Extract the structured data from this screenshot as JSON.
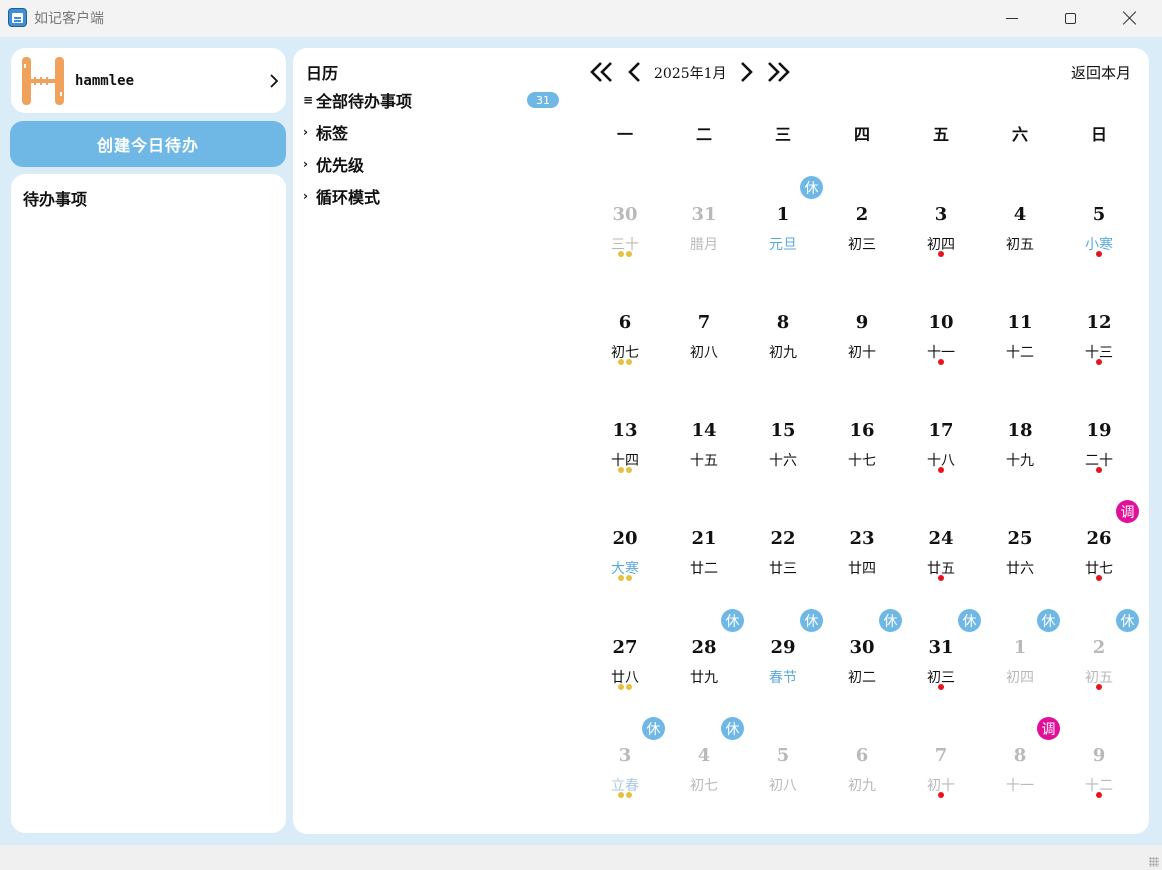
{
  "window": {
    "title": "如记客户端",
    "icon": "calendar-app-icon"
  },
  "user": {
    "name": "hammlee",
    "logo": "H-logo-icon"
  },
  "create_button": {
    "label": "创建今日待办"
  },
  "todo_panel": {
    "title": "待办事项"
  },
  "nav": {
    "title": "日历",
    "items": [
      {
        "label": "全部待办事项",
        "marker": "≡",
        "count": "31"
      },
      {
        "label": "标签",
        "marker": "›"
      },
      {
        "label": "优先级",
        "marker": "›"
      },
      {
        "label": "循环模式",
        "marker": "›"
      }
    ]
  },
  "calendar": {
    "month_label": "2025年1月",
    "back_label": "返回本月",
    "weekdays": [
      "一",
      "二",
      "三",
      "四",
      "五",
      "六",
      "日"
    ],
    "colors": {
      "rest": "#6fb8e6",
      "work": "#e0109a",
      "todo_dot": "#e6c040",
      "event_dot": "#e8141c"
    },
    "rows": [
      [
        {
          "d": "30",
          "l": "三十",
          "out": true,
          "dots": [
            "y",
            "y"
          ]
        },
        {
          "d": "31",
          "l": "腊月",
          "out": true
        },
        {
          "d": "1",
          "l": "元旦",
          "fest": true,
          "badge": "休"
        },
        {
          "d": "2",
          "l": "初三"
        },
        {
          "d": "3",
          "l": "初四",
          "dots": [
            "r"
          ]
        },
        {
          "d": "4",
          "l": "初五"
        },
        {
          "d": "5",
          "l": "小寒",
          "fest": true,
          "dots": [
            "r"
          ]
        }
      ],
      [
        {
          "d": "6",
          "l": "初七",
          "dots": [
            "y",
            "y"
          ]
        },
        {
          "d": "7",
          "l": "初八"
        },
        {
          "d": "8",
          "l": "初九"
        },
        {
          "d": "9",
          "l": "初十"
        },
        {
          "d": "10",
          "l": "十一",
          "dots": [
            "r"
          ]
        },
        {
          "d": "11",
          "l": "十二"
        },
        {
          "d": "12",
          "l": "十三",
          "dots": [
            "r"
          ]
        }
      ],
      [
        {
          "d": "13",
          "l": "十四",
          "dots": [
            "y",
            "y"
          ]
        },
        {
          "d": "14",
          "l": "十五"
        },
        {
          "d": "15",
          "l": "十六"
        },
        {
          "d": "16",
          "l": "十七"
        },
        {
          "d": "17",
          "l": "十八",
          "dots": [
            "r"
          ]
        },
        {
          "d": "18",
          "l": "十九"
        },
        {
          "d": "19",
          "l": "二十",
          "dots": [
            "r"
          ]
        }
      ],
      [
        {
          "d": "20",
          "l": "大寒",
          "fest": true,
          "dots": [
            "y",
            "y"
          ]
        },
        {
          "d": "21",
          "l": "廿二"
        },
        {
          "d": "22",
          "l": "廿三"
        },
        {
          "d": "23",
          "l": "廿四"
        },
        {
          "d": "24",
          "l": "廿五",
          "dots": [
            "r"
          ]
        },
        {
          "d": "25",
          "l": "廿六"
        },
        {
          "d": "26",
          "l": "廿七",
          "dots": [
            "r"
          ],
          "badge": "调"
        }
      ],
      [
        {
          "d": "27",
          "l": "廿八",
          "dots": [
            "y",
            "y"
          ]
        },
        {
          "d": "28",
          "l": "廿九",
          "badge": "休"
        },
        {
          "d": "29",
          "l": "春节",
          "fest": true,
          "badge": "休"
        },
        {
          "d": "30",
          "l": "初二",
          "badge": "休"
        },
        {
          "d": "31",
          "l": "初三",
          "dots": [
            "r"
          ],
          "badge": "休"
        },
        {
          "d": "1",
          "l": "初四",
          "out": true,
          "badge": "休"
        },
        {
          "d": "2",
          "l": "初五",
          "out": true,
          "dots": [
            "r"
          ],
          "badge": "休"
        }
      ],
      [
        {
          "d": "3",
          "l": "立春",
          "out": true,
          "fest": true,
          "dots": [
            "y",
            "y"
          ],
          "badge": "休"
        },
        {
          "d": "4",
          "l": "初七",
          "out": true,
          "badge": "休"
        },
        {
          "d": "5",
          "l": "初八",
          "out": true
        },
        {
          "d": "6",
          "l": "初九",
          "out": true
        },
        {
          "d": "7",
          "l": "初十",
          "out": true,
          "dots": [
            "r"
          ]
        },
        {
          "d": "8",
          "l": "十一",
          "out": true,
          "badge": "调"
        },
        {
          "d": "9",
          "l": "十二",
          "out": true,
          "dots": [
            "r"
          ]
        }
      ]
    ]
  }
}
